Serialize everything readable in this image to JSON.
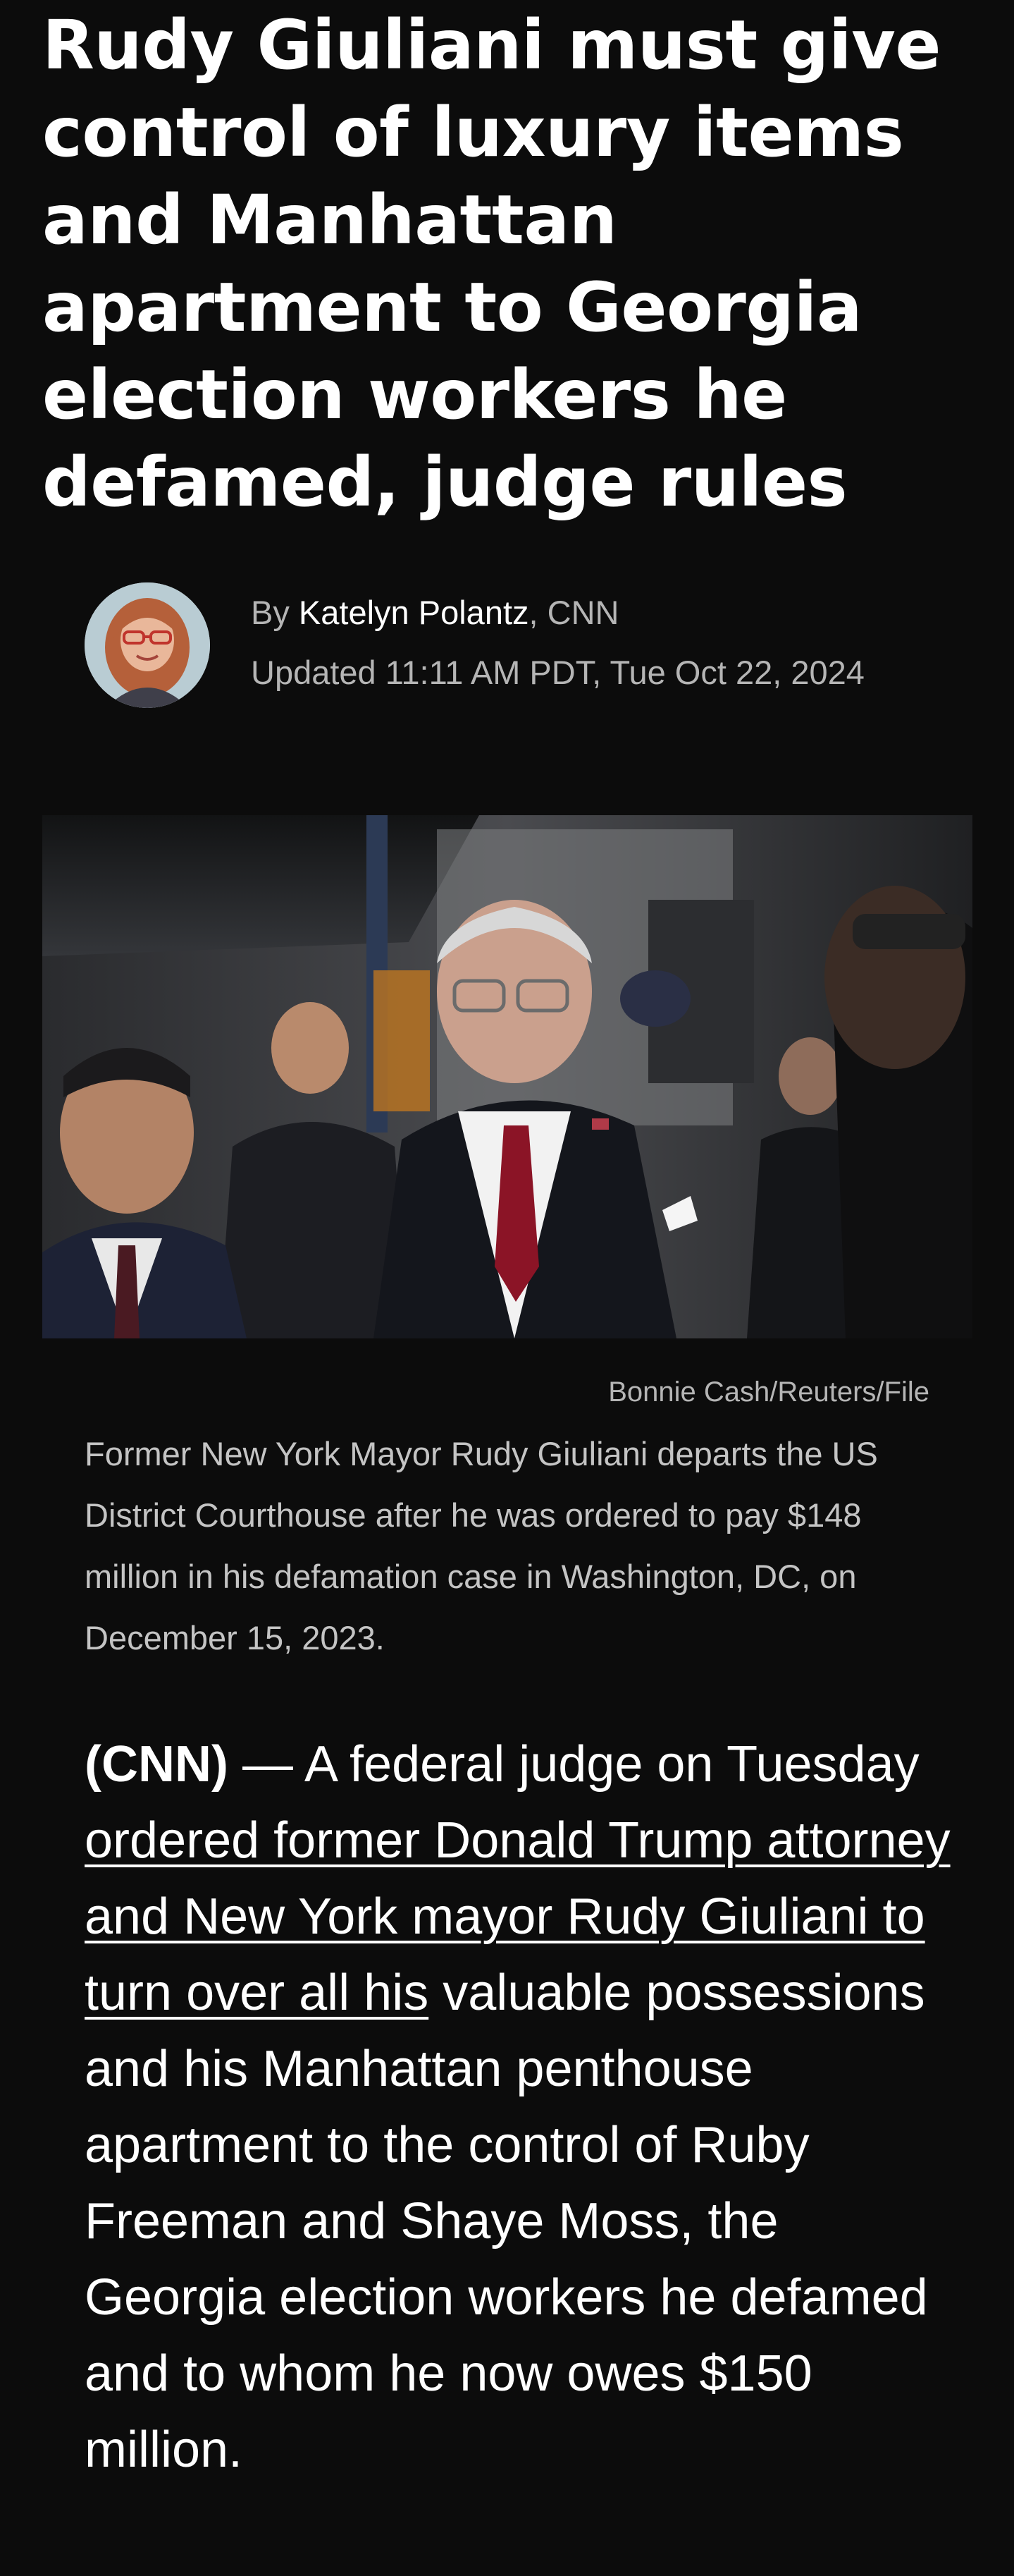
{
  "article": {
    "headline": "Rudy Giuliani must give control of luxury items and Manhattan apartment to Georgia election workers he defamed, judge rules",
    "byline": {
      "prefix": "By",
      "author": "Katelyn  Polantz",
      "outlet": ", CNN",
      "updated": "Updated 11:11 AM PDT, Tue Oct 22, 2024"
    },
    "image": {
      "credit": "Bonnie Cash/Reuters/File",
      "caption": "Former New York Mayor Rudy Giuliani departs the US District Courthouse after he was ordered to pay $148 million in his defamation case in Washington, DC, on December 15, 2023."
    },
    "body": {
      "dateline": "(CNN)",
      "dash": " — A federal judge on Tuesday ",
      "link_text": "ordered former Donald Trump attorney and New York mayor Rudy Giuliani to turn over all his",
      "rest": " valuable possessions and his Manhattan penthouse apartment to the control of Ruby Freeman and Shaye Moss, the Georgia election workers he defamed and to whom he now owes $150 million."
    }
  }
}
